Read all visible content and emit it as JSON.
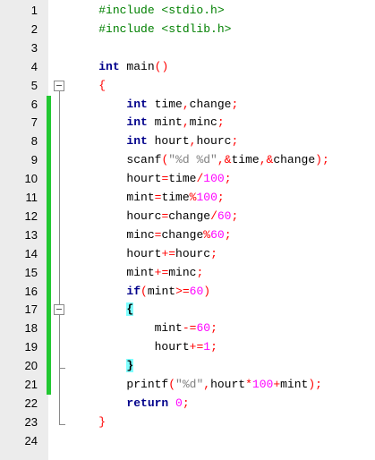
{
  "editor": {
    "lines": [
      {
        "num": "1",
        "tokens": [
          {
            "t": "    "
          },
          {
            "t": "#include <stdio.h>",
            "c": "pp"
          }
        ]
      },
      {
        "num": "2",
        "tokens": [
          {
            "t": "    "
          },
          {
            "t": "#include <stdlib.h>",
            "c": "pp"
          }
        ]
      },
      {
        "num": "3",
        "tokens": []
      },
      {
        "num": "4",
        "tokens": [
          {
            "t": "    "
          },
          {
            "t": "int",
            "c": "kw"
          },
          {
            "t": " main"
          },
          {
            "t": "()",
            "c": "op"
          }
        ]
      },
      {
        "num": "5",
        "tokens": [
          {
            "t": "    "
          },
          {
            "t": "{",
            "c": "brace-red"
          }
        ]
      },
      {
        "num": "6",
        "tokens": [
          {
            "t": "        "
          },
          {
            "t": "int",
            "c": "kw"
          },
          {
            "t": " time"
          },
          {
            "t": ",",
            "c": "op"
          },
          {
            "t": "change"
          },
          {
            "t": ";",
            "c": "op"
          }
        ]
      },
      {
        "num": "7",
        "tokens": [
          {
            "t": "        "
          },
          {
            "t": "int",
            "c": "kw"
          },
          {
            "t": " mint"
          },
          {
            "t": ",",
            "c": "op"
          },
          {
            "t": "minc"
          },
          {
            "t": ";",
            "c": "op"
          }
        ]
      },
      {
        "num": "8",
        "tokens": [
          {
            "t": "        "
          },
          {
            "t": "int",
            "c": "kw"
          },
          {
            "t": " hourt"
          },
          {
            "t": ",",
            "c": "op"
          },
          {
            "t": "hourc"
          },
          {
            "t": ";",
            "c": "op"
          }
        ]
      },
      {
        "num": "9",
        "tokens": [
          {
            "t": "        "
          },
          {
            "t": "scanf"
          },
          {
            "t": "(",
            "c": "op"
          },
          {
            "t": "\"%d %d\"",
            "c": "str"
          },
          {
            "t": ",",
            "c": "op"
          },
          {
            "t": "&",
            "c": "op"
          },
          {
            "t": "time"
          },
          {
            "t": ",",
            "c": "op"
          },
          {
            "t": "&",
            "c": "op"
          },
          {
            "t": "change"
          },
          {
            "t": ");",
            "c": "op"
          }
        ]
      },
      {
        "num": "10",
        "tokens": [
          {
            "t": "        "
          },
          {
            "t": "hourt"
          },
          {
            "t": "=",
            "c": "op"
          },
          {
            "t": "time"
          },
          {
            "t": "/",
            "c": "op"
          },
          {
            "t": "100",
            "c": "num"
          },
          {
            "t": ";",
            "c": "op"
          }
        ]
      },
      {
        "num": "11",
        "tokens": [
          {
            "t": "        "
          },
          {
            "t": "mint"
          },
          {
            "t": "=",
            "c": "op"
          },
          {
            "t": "time"
          },
          {
            "t": "%",
            "c": "op"
          },
          {
            "t": "100",
            "c": "num"
          },
          {
            "t": ";",
            "c": "op"
          }
        ]
      },
      {
        "num": "12",
        "tokens": [
          {
            "t": "        "
          },
          {
            "t": "hourc"
          },
          {
            "t": "=",
            "c": "op"
          },
          {
            "t": "change"
          },
          {
            "t": "/",
            "c": "op"
          },
          {
            "t": "60",
            "c": "num"
          },
          {
            "t": ";",
            "c": "op"
          }
        ]
      },
      {
        "num": "13",
        "tokens": [
          {
            "t": "        "
          },
          {
            "t": "minc"
          },
          {
            "t": "=",
            "c": "op"
          },
          {
            "t": "change"
          },
          {
            "t": "%",
            "c": "op"
          },
          {
            "t": "60",
            "c": "num"
          },
          {
            "t": ";",
            "c": "op"
          }
        ]
      },
      {
        "num": "14",
        "tokens": [
          {
            "t": "        "
          },
          {
            "t": "hourt"
          },
          {
            "t": "+=",
            "c": "op"
          },
          {
            "t": "hourc"
          },
          {
            "t": ";",
            "c": "op"
          }
        ]
      },
      {
        "num": "15",
        "tokens": [
          {
            "t": "        "
          },
          {
            "t": "mint"
          },
          {
            "t": "+=",
            "c": "op"
          },
          {
            "t": "minc"
          },
          {
            "t": ";",
            "c": "op"
          }
        ]
      },
      {
        "num": "16",
        "tokens": [
          {
            "t": "        "
          },
          {
            "t": "if",
            "c": "kw"
          },
          {
            "t": "(",
            "c": "op"
          },
          {
            "t": "mint"
          },
          {
            "t": ">=",
            "c": "op"
          },
          {
            "t": "60",
            "c": "num"
          },
          {
            "t": ")",
            "c": "op"
          }
        ]
      },
      {
        "num": "17",
        "tokens": [
          {
            "t": "        "
          },
          {
            "t": "{",
            "c": "hl-brace"
          }
        ]
      },
      {
        "num": "18",
        "tokens": [
          {
            "t": "            "
          },
          {
            "t": "mint"
          },
          {
            "t": "-=",
            "c": "op"
          },
          {
            "t": "60",
            "c": "num"
          },
          {
            "t": ";",
            "c": "op"
          }
        ]
      },
      {
        "num": "19",
        "tokens": [
          {
            "t": "            "
          },
          {
            "t": "hourt"
          },
          {
            "t": "+=",
            "c": "op"
          },
          {
            "t": "1",
            "c": "num"
          },
          {
            "t": ";",
            "c": "op"
          }
        ]
      },
      {
        "num": "20",
        "tokens": [
          {
            "t": "        "
          },
          {
            "t": "}",
            "c": "hl-brace"
          }
        ]
      },
      {
        "num": "21",
        "tokens": [
          {
            "t": "        "
          },
          {
            "t": "printf"
          },
          {
            "t": "(",
            "c": "op"
          },
          {
            "t": "\"%d\"",
            "c": "str"
          },
          {
            "t": ",",
            "c": "op"
          },
          {
            "t": "hourt"
          },
          {
            "t": "*",
            "c": "op"
          },
          {
            "t": "100",
            "c": "num"
          },
          {
            "t": "+",
            "c": "op"
          },
          {
            "t": "mint"
          },
          {
            "t": ");",
            "c": "op"
          }
        ]
      },
      {
        "num": "22",
        "tokens": [
          {
            "t": "        "
          },
          {
            "t": "return",
            "c": "kw"
          },
          {
            "t": " "
          },
          {
            "t": "0",
            "c": "num"
          },
          {
            "t": ";",
            "c": "op"
          }
        ]
      },
      {
        "num": "23",
        "tokens": [
          {
            "t": "    "
          },
          {
            "t": "}",
            "c": "brace-red"
          }
        ]
      },
      {
        "num": "24",
        "tokens": []
      }
    ],
    "changed_lines": [
      6,
      21
    ],
    "fold_markers": [
      5,
      17
    ]
  },
  "colors": {
    "keyword": "#00008b",
    "preprocessor": "#008000",
    "string": "#808080",
    "number": "#ff00ff",
    "operator": "#ff0000",
    "change_bar": "#22c832",
    "brace_highlight": "#7fffff",
    "gutter": "#ececec"
  }
}
